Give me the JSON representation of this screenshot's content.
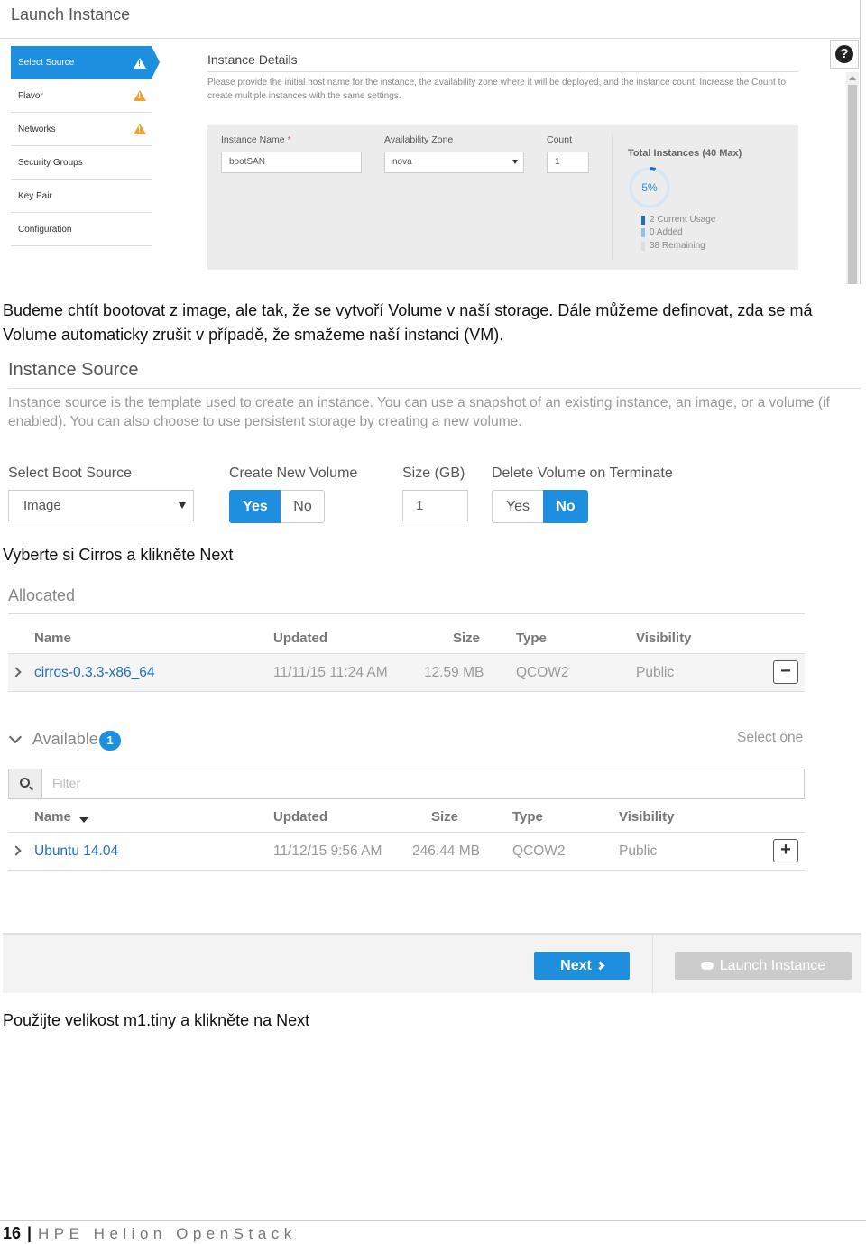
{
  "launch": {
    "title": "Launch Instance",
    "steps": [
      {
        "label": "Select Source",
        "warning": true
      },
      {
        "label": "Flavor",
        "warning": true
      },
      {
        "label": "Networks",
        "warning": true
      },
      {
        "label": "Security Groups",
        "warning": false
      },
      {
        "label": "Key Pair",
        "warning": false
      },
      {
        "label": "Configuration",
        "warning": false
      }
    ],
    "section_title": "Instance Details",
    "section_desc": "Please provide the initial host name for the instance, the availability zone where it will be deployed, and the instance count. Increase the Count to create multiple instances with the same settings.",
    "instance_name_label": "Instance Name",
    "required_mark": "*",
    "instance_name_value": "bootSAN",
    "availability_zone_label": "Availability Zone",
    "availability_zone_value": "nova",
    "count_label": "Count",
    "count_value": "1",
    "total_title": "Total Instances (40 Max)",
    "usage_percent": 5,
    "usage_label": "5%",
    "legend": [
      {
        "text": "2 Current Usage",
        "color": "#1e6fbe"
      },
      {
        "text": "0 Added",
        "color": "#8fc1ea"
      },
      {
        "text": "38 Remaining",
        "color": "#ddd"
      }
    ],
    "help_icon": "?"
  },
  "paragraphs": {
    "p1": "Budeme chtít bootovat z image, ale tak, že se vytvoří Volume v naší storage. Dále můžeme definovat, zda se má Volume automaticky zrušit v případě, že smažeme naší instanci (VM).",
    "p2": "Vyberte si Cirros a klikněte Next",
    "p3": "Použijte velikost m1.tiny a klikněte na Next"
  },
  "source": {
    "title": "Instance Source",
    "desc": "Instance source is the template used to create an instance. You can use a snapshot of an existing instance, an image, or a volume (if enabled). You can also choose to use persistent storage by creating a new volume.",
    "boot_source_label": "Select Boot Source",
    "boot_source_value": "Image",
    "create_volume_label": "Create New Volume",
    "size_label": "Size (GB)",
    "size_value": "1",
    "delete_volume_label": "Delete Volume on Terminate",
    "yes": "Yes",
    "no": "No"
  },
  "allocated": {
    "title": "Allocated",
    "headers": {
      "name": "Name",
      "updated": "Updated",
      "size": "Size",
      "type": "Type",
      "visibility": "Visibility"
    },
    "row": {
      "name": "cirros-0.3.3-x86_64",
      "updated": "11/11/15 11:24 AM",
      "size": "12.59 MB",
      "type": "QCOW2",
      "visibility": "Public",
      "action": "−"
    }
  },
  "available": {
    "title": "Available",
    "count": "1",
    "select_hint": "Select one",
    "filter_placeholder": "Filter",
    "headers": {
      "name": "Name",
      "updated": "Updated",
      "size": "Size",
      "type": "Type",
      "visibility": "Visibility"
    },
    "row": {
      "name": "Ubuntu 14.04",
      "updated": "11/12/15 9:56 AM",
      "size": "246.44 MB",
      "type": "QCOW2",
      "visibility": "Public",
      "action": "+"
    }
  },
  "buttons": {
    "next": "Next",
    "launch": "Launch Instance"
  },
  "footer": {
    "page": "16",
    "sep": "|",
    "brand": "HPE Helion OpenStack"
  }
}
